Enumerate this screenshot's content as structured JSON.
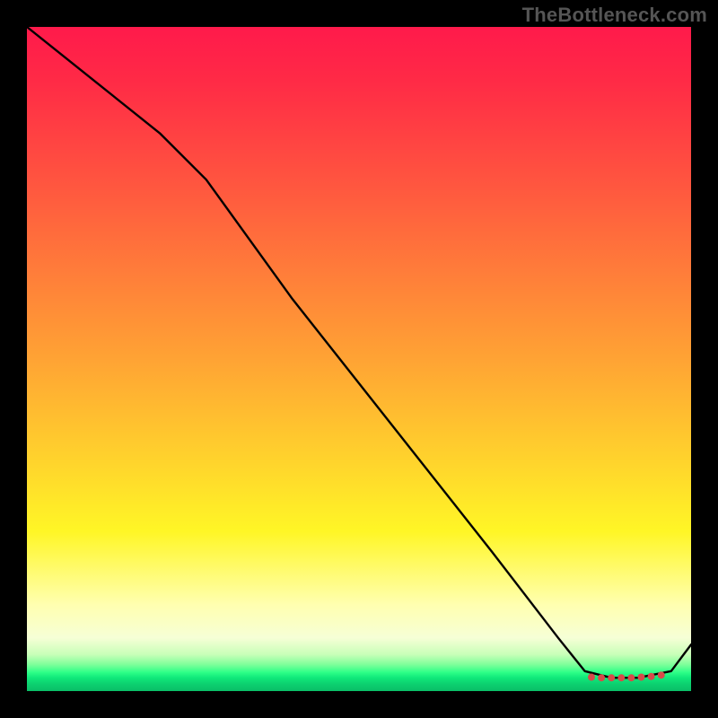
{
  "watermark": "TheBottleneck.com",
  "chart_data": {
    "type": "line",
    "title": "",
    "xlabel": "",
    "ylabel": "",
    "xlim": [
      0,
      100
    ],
    "ylim": [
      0,
      100
    ],
    "grid": false,
    "legend": false,
    "series": [
      {
        "name": "curve",
        "x": [
          0,
          10,
          20,
          27,
          40,
          55,
          70,
          80,
          84,
          88,
          92,
          97,
          100
        ],
        "y": [
          100,
          92,
          84,
          77,
          59,
          40,
          21,
          8,
          3,
          2,
          2,
          3,
          7
        ]
      }
    ],
    "markers": {
      "name": "bottom-cluster",
      "points_x": [
        85,
        86.5,
        88,
        89.5,
        91,
        92.5,
        94,
        95.5
      ],
      "points_y": [
        2.1,
        2.0,
        2.0,
        2.0,
        2.0,
        2.1,
        2.2,
        2.4
      ],
      "color": "#d84a4a",
      "radius": 4
    },
    "gradient_stops": [
      {
        "pos": 0,
        "color": "#ff1a4b"
      },
      {
        "pos": 0.22,
        "color": "#ff5140"
      },
      {
        "pos": 0.5,
        "color": "#ffa334"
      },
      {
        "pos": 0.76,
        "color": "#fff626"
      },
      {
        "pos": 0.92,
        "color": "#f6ffd6"
      },
      {
        "pos": 0.97,
        "color": "#2dff87"
      },
      {
        "pos": 1.0,
        "color": "#0abf68"
      }
    ]
  }
}
